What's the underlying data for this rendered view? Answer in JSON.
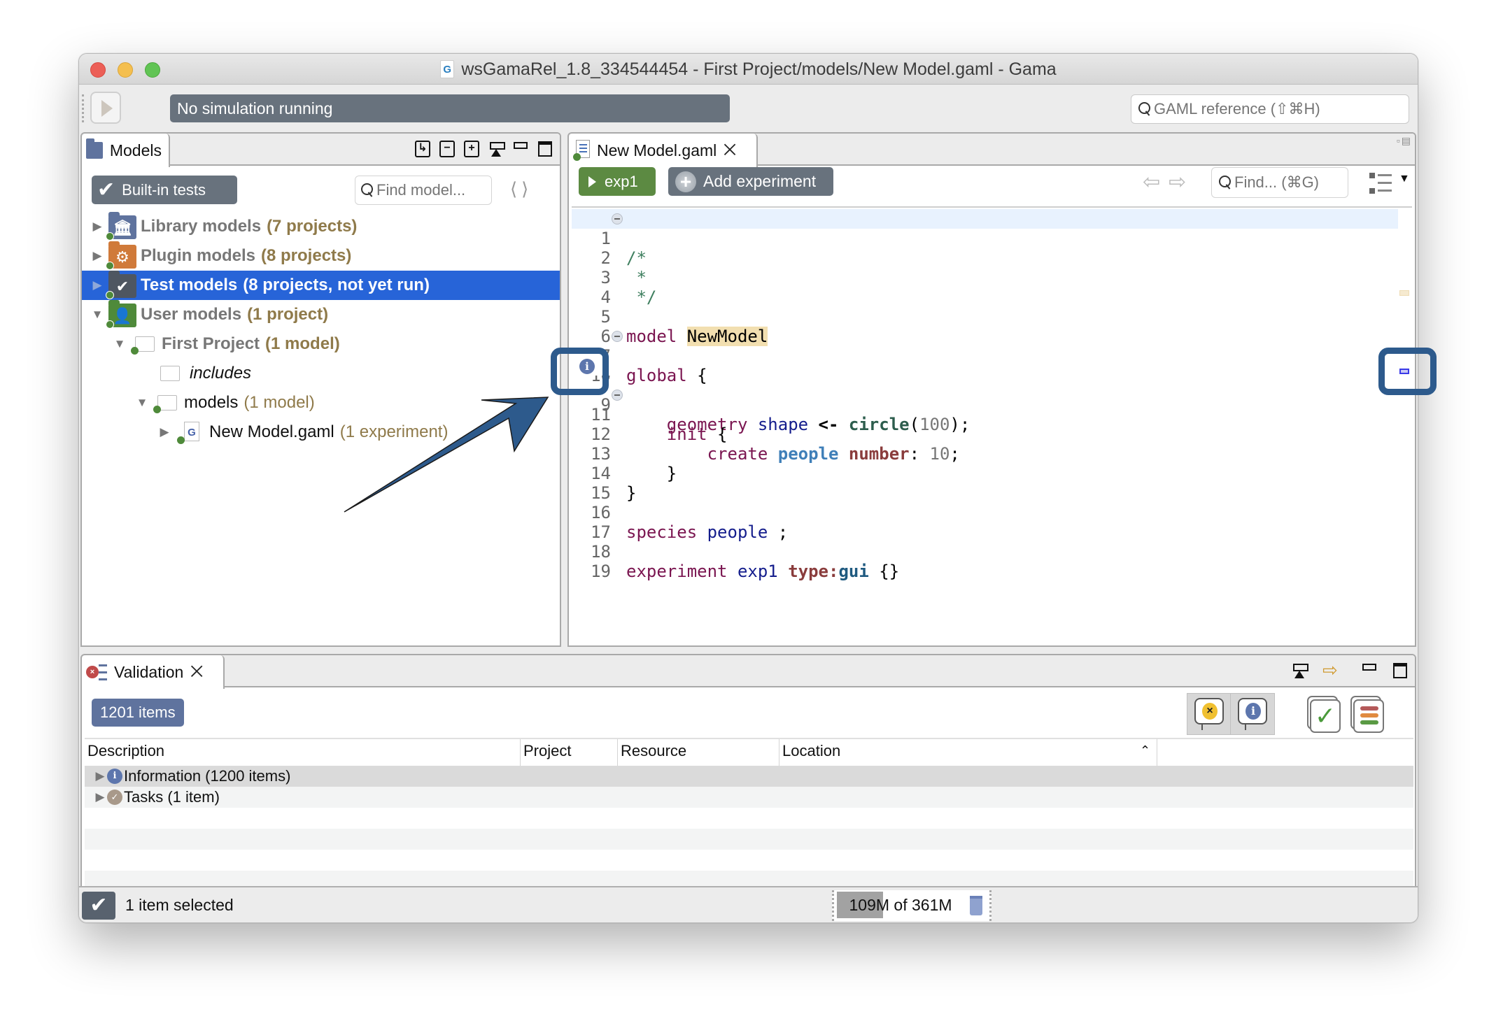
{
  "window": {
    "title": "wsGamaRel_1.8_334544454 - First Project/models/New Model.gaml - Gama"
  },
  "toolbar": {
    "simulation_status": "No simulation running",
    "gaml_reference_placeholder": "GAML reference (⇧⌘H)"
  },
  "models_view": {
    "tab_label": "Models",
    "builtin_tests_label": "Built-in tests",
    "find_placeholder": "Find model...",
    "tree": [
      {
        "label": "Library models",
        "count": "(7 projects)",
        "expanded": false,
        "icon": "library-icon",
        "color": "#5f739e"
      },
      {
        "label": "Plugin models",
        "count": "(8 projects)",
        "expanded": false,
        "icon": "gear-icon",
        "color": "#d07a3a"
      },
      {
        "label": "Test models",
        "count": "(8 projects, not yet run)",
        "expanded": false,
        "icon": "check-icon",
        "color": "#4e5661",
        "selected": true
      },
      {
        "label": "User models",
        "count": "(1 project)",
        "expanded": true,
        "icon": "user-icon",
        "color": "#4f8a3a"
      },
      {
        "label": "First Project",
        "count": "(1 model)",
        "expanded": true
      },
      {
        "label": "includes"
      },
      {
        "label": "models",
        "count": "(1 model)",
        "expanded": true
      },
      {
        "label": "New Model.gaml",
        "count": "(1 experiment)",
        "expanded": false
      }
    ]
  },
  "editor": {
    "tab_label": "New Model.gaml",
    "experiment_button": "exp1",
    "add_experiment_button": "Add experiment",
    "find_placeholder": "Find... (⌘G)",
    "line_numbers": [
      "1",
      "2",
      "3",
      "4",
      "5",
      "6",
      "7",
      "8",
      "9",
      "10",
      "11",
      "12",
      "13",
      "14",
      "15",
      "16",
      "17",
      "18",
      "19"
    ],
    "code": {
      "l1": "/*",
      "l2": " *",
      "l3": " */",
      "l5_kw": "model",
      "l5_name": "NewModel",
      "l7_kw": "global",
      "l7_brace": "{",
      "l9_type": "geometry",
      "l9_var": "shape",
      "l9_op": "<-",
      "l9_fn": "circle",
      "l9_open": "(",
      "l9_num": "100",
      "l9_close": ");",
      "l11_kw": "init",
      "l11_brace": "{",
      "l12_kw": "create",
      "l12_species": "people",
      "l12_attr": "number",
      "l12_colon": ":",
      "l12_num": "10",
      "l12_semi": ";",
      "l13": "}",
      "l14": "}",
      "l16_kw": "species",
      "l16_name": "people",
      "l16_semi": ";",
      "l18_kw": "experiment",
      "l18_name": "exp1",
      "l18_attr": "type:",
      "l18_val": "gui",
      "l18_braces": "{}"
    }
  },
  "validation": {
    "tab_label": "Validation",
    "count_badge": "1201 items",
    "columns": [
      "Description",
      "Project",
      "Resource",
      "Location"
    ],
    "rows": [
      {
        "description": "Information (1200 items)",
        "icon": "info-icon"
      },
      {
        "description": "Tasks (1 item)",
        "icon": "task-icon"
      }
    ]
  },
  "status_bar": {
    "selection_text": "1 item selected",
    "memory_text": "109M of 361M",
    "memory_used_fraction": 0.3
  },
  "colors": {
    "accent_selection": "#2764d8",
    "button_gray": "#68727d",
    "experiment_green": "#5c8a42",
    "annotation_blue": "#2d5a8c"
  }
}
